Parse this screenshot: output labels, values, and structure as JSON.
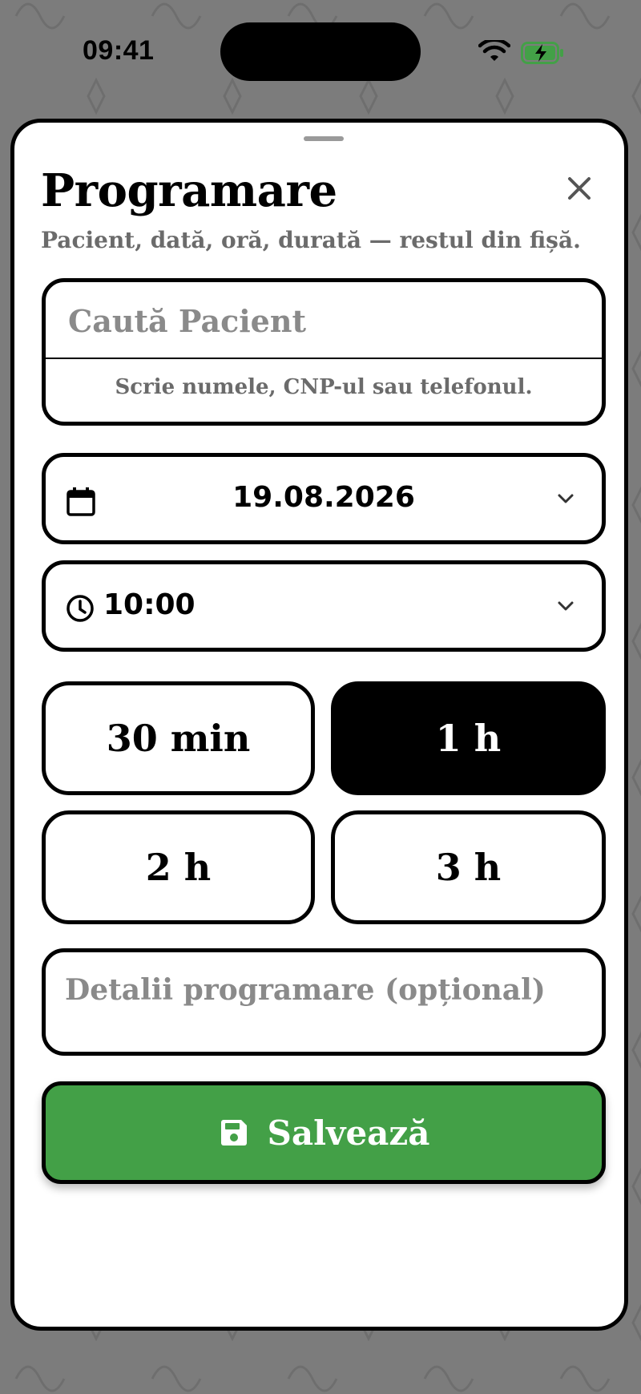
{
  "status_bar": {
    "time": "09:41"
  },
  "sheet": {
    "title": "Programare",
    "subtitle": "Pacient, dată, oră, durată — restul din fișă."
  },
  "search": {
    "placeholder": "Caută Pacient",
    "hint": "Scrie numele, CNP-ul sau telefonul."
  },
  "date_picker": {
    "value": "19.08.2026",
    "icon": "calendar-icon"
  },
  "time_picker": {
    "value": "10:00",
    "icon": "clock-icon"
  },
  "durations": {
    "options": [
      "30 min",
      "1 h",
      "2 h",
      "3 h"
    ],
    "selected": "1 h"
  },
  "details": {
    "placeholder": "Detalii programare (opțional)"
  },
  "save_button": {
    "label": "Salvează",
    "icon": "floppy-disk-icon"
  },
  "colors": {
    "primary": "#43a047",
    "background": "#7c7c7c",
    "selected": "#000000"
  }
}
